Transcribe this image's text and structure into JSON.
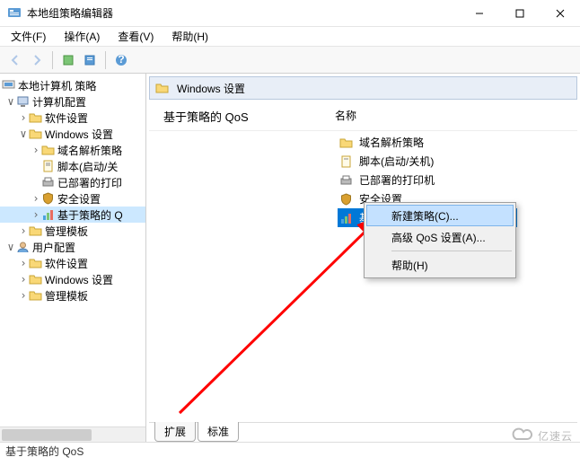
{
  "window": {
    "title": "本地组策略编辑器",
    "controls": {
      "min": "–",
      "max": "☐",
      "close": "✕"
    }
  },
  "menu": {
    "file": "文件(F)",
    "action": "操作(A)",
    "view": "查看(V)",
    "help": "帮助(H)"
  },
  "tree": {
    "root": "本地计算机 策略",
    "computer": "计算机配置",
    "software": "软件设置",
    "windows_settings": "Windows 设置",
    "dns_policy": "域名解析策略",
    "scripts": "脚本(启动/关",
    "printers": "已部署的打印",
    "security": "安全设置",
    "qos": "基于策略的 Q",
    "admin_templates": "管理模板",
    "user": "用户配置",
    "user_software": "软件设置",
    "user_windows": "Windows 设置",
    "user_templates": "管理模板"
  },
  "breadcrumb": {
    "label": "Windows 设置"
  },
  "section_header": "基于策略的 QoS",
  "column_header": "名称",
  "items": {
    "dns": "域名解析策略",
    "scripts": "脚本(启动/关机)",
    "printers": "已部署的打印机",
    "security": "安全设置",
    "qos": "基于策略的 QoS"
  },
  "context_menu": {
    "new_policy": "新建策略(C)...",
    "advanced": "高级 QoS 设置(A)...",
    "help": "帮助(H)"
  },
  "tabs": {
    "extended": "扩展",
    "standard": "标准"
  },
  "status": "基于策略的 QoS",
  "watermark": "亿速云"
}
